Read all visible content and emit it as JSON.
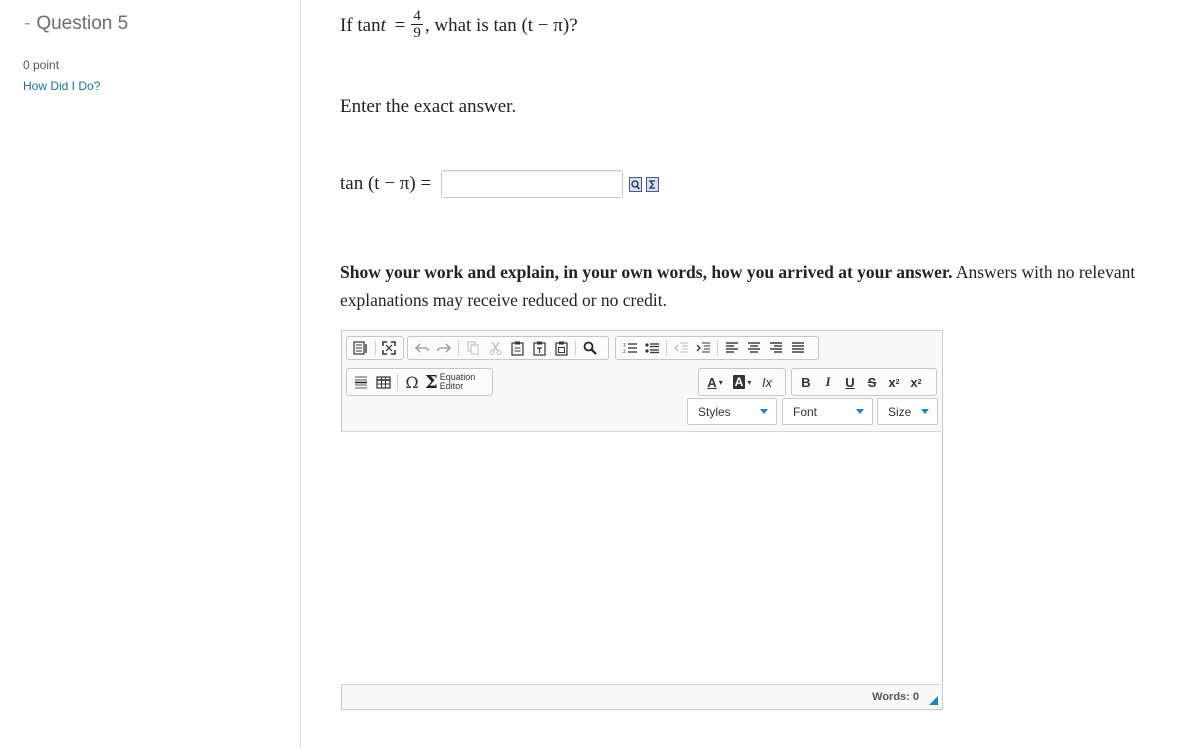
{
  "sidebar": {
    "question_title": "Question 5",
    "points": "0 point",
    "how_link": "How Did I Do?"
  },
  "question": {
    "prompt_if": "If",
    "prompt_func": "tan",
    "prompt_var": "t",
    "prompt_eq": "=",
    "frac_num": "4",
    "frac_den": "9",
    "prompt_rest": ", what is",
    "prompt_expr": "tan (t − π)?",
    "instruction": "Enter the exact answer.",
    "answer_label": "tan (t − π) =",
    "answer_value": ""
  },
  "explain": {
    "bold": "Show your work and explain, in your own words, how you arrived at your answer.",
    "normal": " Answers with no relevant explanations may receive reduced or no credit."
  },
  "editor": {
    "equation_editor_line1": "Equation",
    "equation_editor_line2": "Editor",
    "styles_label": "Styles",
    "font_label": "Font",
    "size_label": "Size",
    "word_count": "Words: 0",
    "bold_glyph": "B",
    "italic_glyph": "I",
    "underline_glyph": "U",
    "strike_glyph": "S",
    "text_color_glyph": "A",
    "bg_color_glyph": "A",
    "remove_format_glyph": "Ix",
    "omega_glyph": "Ω",
    "sigma_glyph": "Σ"
  },
  "colors": {
    "accent": "#2a7fc0",
    "link": "#1f6fa8"
  }
}
